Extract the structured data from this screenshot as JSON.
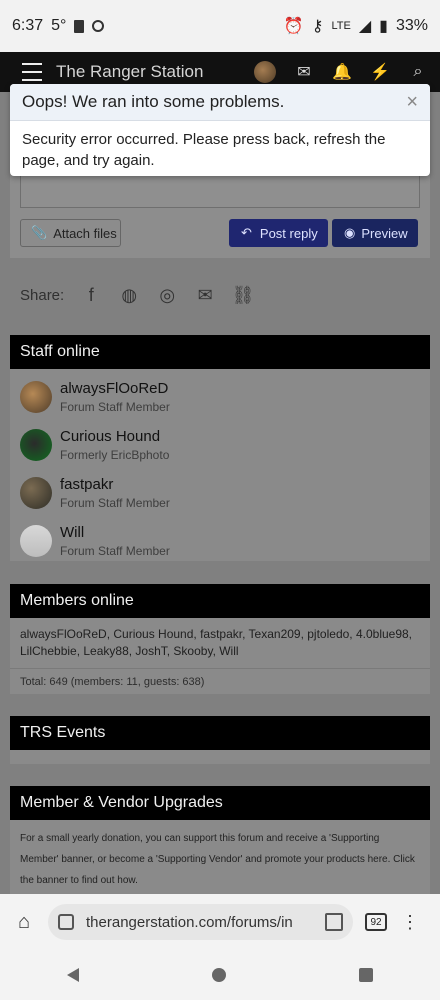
{
  "statusbar": {
    "time": "6:37",
    "temp": "5°",
    "battery": "33%",
    "network": "LTE"
  },
  "header": {
    "title": "The Ranger Station"
  },
  "alert": {
    "title": "Oops! We ran into some problems.",
    "message": "Security error occurred. Please press back, refresh the page, and try again.",
    "close_icon": "×"
  },
  "reply": {
    "attach_label": "Attach files",
    "post_reply_label": "Post reply",
    "preview_label": "Preview"
  },
  "share": {
    "label": "Share:"
  },
  "staff": {
    "title": "Staff online",
    "members": [
      {
        "name": "alwaysFlOoReD",
        "role": "Forum Staff Member"
      },
      {
        "name": "Curious Hound",
        "role": "Formerly EricBphoto"
      },
      {
        "name": "fastpakr",
        "role": "Forum Staff Member"
      },
      {
        "name": "Will",
        "role": "Forum Staff Member"
      }
    ]
  },
  "online": {
    "title": "Members online",
    "list": "alwaysFlOoReD, Curious Hound, fastpakr, Texan209, pjtoledo, 4.0blue98, LilChebbie, Leaky88, JoshT, Skooby, Will",
    "total": "Total: 649 (members: 11, guests: 638)"
  },
  "events": {
    "title": "TRS Events"
  },
  "upgrades": {
    "title": "Member & Vendor Upgrades",
    "text": "For a small yearly donation, you can support this forum and receive a 'Supporting Member' banner, or become a 'Supporting Vendor' and promote your products here. Click the banner to find out how."
  },
  "browser": {
    "url": "therangerstation.com/forums/in",
    "tabs": "92"
  },
  "colors": {
    "header_bg": "#111111",
    "button_primary": "#1f2670",
    "block_head": "#000000"
  }
}
